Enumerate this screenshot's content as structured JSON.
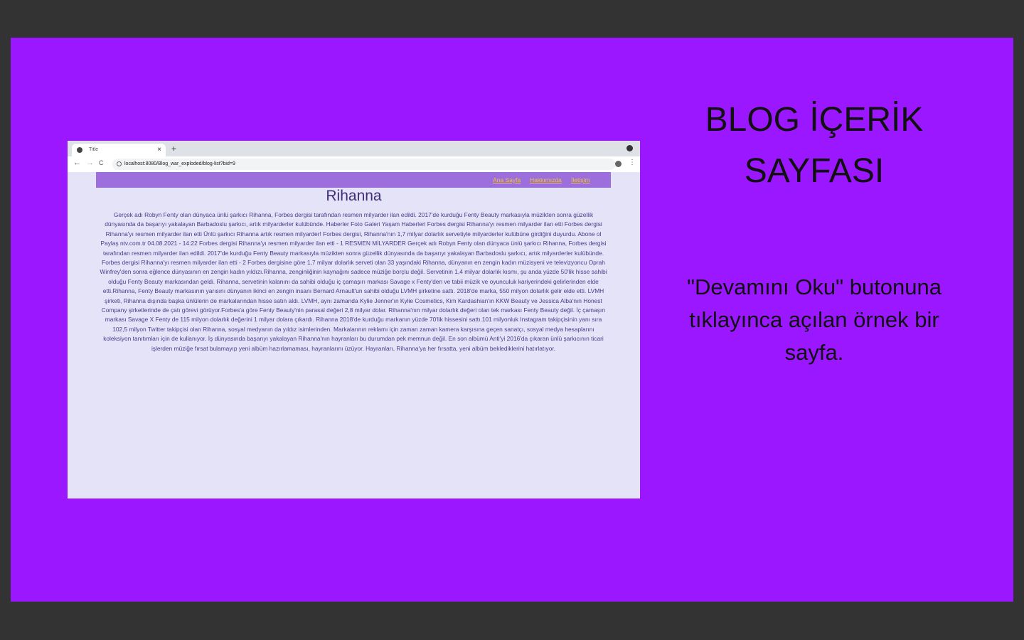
{
  "slide": {
    "title_line1": "BLOG İÇERİK",
    "title_line2": "SAYFASI",
    "description": "\"Devamını Oku\" butonuna tıklayınca açılan örnek bir sayfa."
  },
  "browser": {
    "tab_title": "Title",
    "tab_close": "×",
    "new_tab": "+",
    "back": "←",
    "forward": "→",
    "reload": "C",
    "url": "localhost:8080/Blog_war_exploded/blog-list?bid=9",
    "bookmark_icon": "☆",
    "menu_icon": "⋮"
  },
  "site": {
    "nav": [
      "Ana Sayfa",
      "Hakkımızda",
      "İletişim"
    ],
    "post_title": "Rihanna",
    "post_body": "Gerçek adı Robyn Fenty olan dünyaca ünlü şarkıcı Rihanna, Forbes dergisi tarafından resmen milyarder ilan edildi. 2017'de kurduğu Fenty Beauty markasıyla müzikten sonra güzellik dünyasında da başarıyı yakalayan Barbadoslu şarkıcı, artık milyarderler kulübünde. Haberler Foto Galeri Yaşam Haberleri Forbes dergisi Rihanna'yı resmen milyarder ilan etti Forbes dergisi Rihanna'yı resmen milyarder ilan etti Ünlü şarkıcı Rihanna artık resmen milyarder! Forbes dergisi, Rihanna'nın 1,7 milyar dolarlık servetiyle milyarderler kulübüne girdiğini duyurdu. Abone ol Paylaş ntv.com.tr 04.08.2021 - 14:22 Forbes dergisi Rihanna'yı resmen milyarder ilan etti - 1 RESMEN MİLYARDER Gerçek adı Robyn Fenty olan dünyaca ünlü şarkıcı Rihanna, Forbes dergisi tarafından resmen milyarder ilan edildi. 2017'de kurduğu Fenty Beauty markasıyla müzikten sonra güzellik dünyasında da başarıyı yakalayan Barbadoslu şarkıcı, artık milyarderler kulübünde. Forbes dergisi Rihanna'yı resmen milyarder ilan etti - 2 Forbes dergisine göre 1,7 milyar dolarlık serveti olan 33 yaşındaki Rihanna, dünyanın en zengin kadın müzisyeni ve televizyoncu Oprah Winfrey'den sonra eğlence dünyasının en zengin kadın yıldızı.Rihanna, zenginliğinin kaynağını sadece müziğe borçlu değil. Servetinin 1,4 milyar dolarlık kısmı, şu anda yüzde 50'lik hisse sahibi olduğu Fenty Beauty markasından geldi. Rihanna, servetinin kalanını da sahibi olduğu iç çamaşırı markası Savage x Fenty'den ve tabii müzik ve oyunculuk kariyerindeki gelirlerinden elde etti.Rihanna, Fenty Beauty markasının yarısını dünyanın ikinci en zengin insanı Bernard Arnault'un sahibi olduğu LVMH şirketine sattı. 2018'de marka, 550 milyon dolarlık gelir elde etti. LVMH şirketi, Rihanna dışında başka ünlülerin de markalarından hisse satın aldı. LVMH, aynı zamanda Kylie Jenner'ın Kylie Cosmetics, Kim Kardashian'ın KKW Beauty ve Jessica Alba'nın Honest Company şirketlerinde de çatı görevi görüyor.Forbes'a göre Fenty Beauty'nin parasal değeri 2,8 milyar dolar. Rihanna'nın milyar dolarlık değeri olan tek markası Fenty Beauty değil. İç çamaşırı markası Savage X Fenty de 115 milyon dolarlık değerini 1 milyar dolara çıkardı. Rihanna 2018'de kurduğu markanın yüzde 70'lik hissesini sattı.101 milyonluk Instagram takipçisinin yanı sıra 102,5 milyon Twitter takipçisi olan Rihanna, sosyal medyanın da yıldız isimlerinden. Markalarının reklamı için zaman zaman kamera karşısına geçen sanatçı, sosyal medya hesaplarını koleksiyon tanıtımları için de kullanıyor. İş dünyasında başarıyı yakalayan Rihanna'nın hayranları bu durumdan pek memnun değil. En son albümü Anti'yi 2016'da çıkaran ünlü şarkıcının ticari işlerden müziğe fırsat bulamayıp yeni albüm hazırlamaması, hayranlarını üzüyor. Hayranları, Rihanna'ya her fırsatta, yeni albüm beklediklerini hatırlatıyor."
  },
  "colors": {
    "slide_bg": "#9b17ff",
    "outer_bg": "#333333",
    "page_bg": "#e5e3f8",
    "nav_bg": "#9d6fdc",
    "nav_link": "#f0c23a",
    "title_text": "#3f2d77"
  }
}
